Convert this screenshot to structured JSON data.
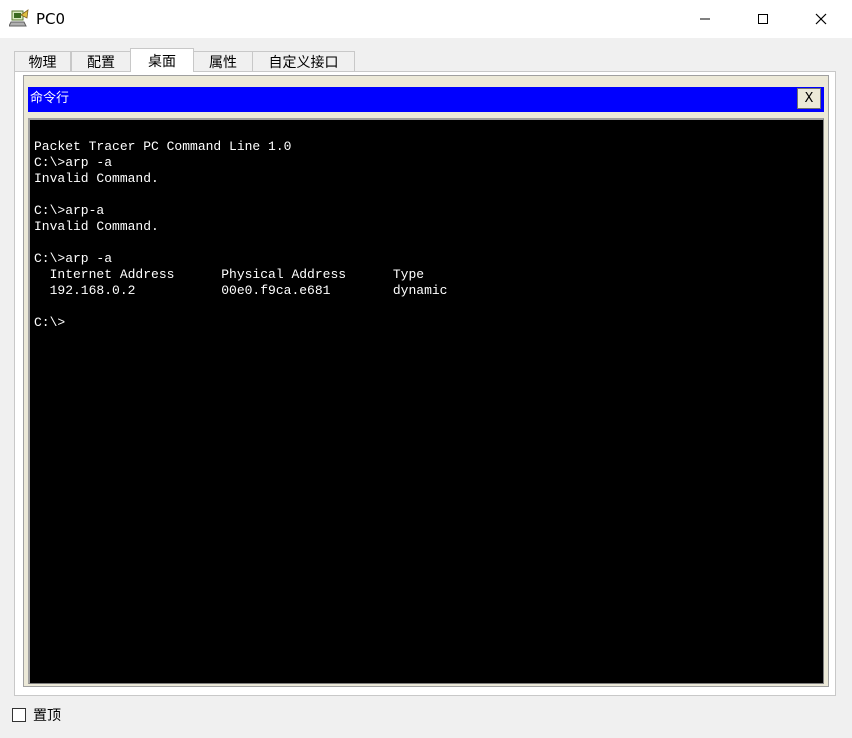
{
  "window": {
    "title": "PC0",
    "controls": [
      "minimize",
      "maximize",
      "close"
    ]
  },
  "tabs": [
    {
      "label": "物理",
      "active": false
    },
    {
      "label": "配置",
      "active": false
    },
    {
      "label": "桌面",
      "active": true
    },
    {
      "label": "属性",
      "active": false
    },
    {
      "label": "自定义接口",
      "active": false
    }
  ],
  "command_window": {
    "title": "命令行",
    "close_label": "X",
    "header_color": "#0000ff",
    "lines": [
      "Packet Tracer PC Command Line 1.0",
      "C:\\>arp -a",
      "Invalid Command.",
      "",
      "C:\\>arp-a",
      "Invalid Command.",
      "",
      "C:\\>arp -a",
      "  Internet Address      Physical Address      Type",
      "  192.168.0.2           00e0.f9ca.e681        dynamic",
      "",
      "C:\\>"
    ]
  },
  "footer": {
    "always_on_top_label": "置顶",
    "always_on_top_checked": false
  }
}
